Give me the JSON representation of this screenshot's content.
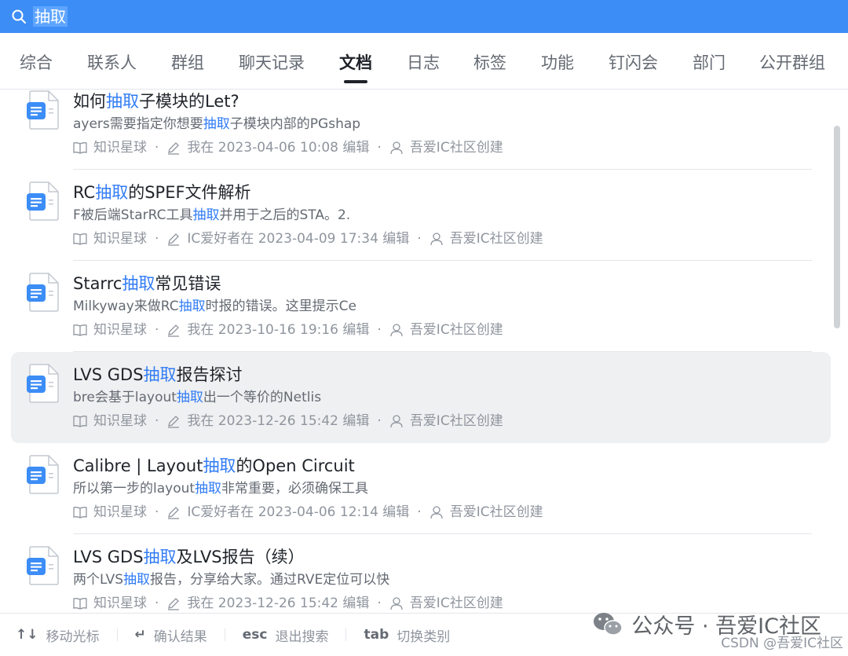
{
  "search": {
    "query": "抽取"
  },
  "tabs": [
    {
      "label": "综合"
    },
    {
      "label": "联系人"
    },
    {
      "label": "群组"
    },
    {
      "label": "聊天记录"
    },
    {
      "label": "文档",
      "active": true
    },
    {
      "label": "日志"
    },
    {
      "label": "标签"
    },
    {
      "label": "功能"
    },
    {
      "label": "钉闪会"
    },
    {
      "label": "部门"
    },
    {
      "label": "公开群组"
    }
  ],
  "results": [
    {
      "title_pre": "如何",
      "title_hl": "抽取",
      "title_post": "子模块的Let?",
      "snippet_pre": "ayers需要指定你想要",
      "snippet_hl": "抽取",
      "snippet_post": "子模块内部的PGshap",
      "space": "知识星球",
      "edited": "我在 2023-04-06 10:08 编辑",
      "creator": "吾爱IC社区创建"
    },
    {
      "title_pre": "RC",
      "title_hl": "抽取",
      "title_post": "的SPEF文件解析",
      "snippet_pre": "F被后端StarRC工具",
      "snippet_hl": "抽取",
      "snippet_post": "并用于之后的STA。2.",
      "space": "知识星球",
      "edited": "IC爱好者在 2023-04-09 17:34 编辑",
      "creator": "吾爱IC社区创建"
    },
    {
      "title_pre": "Starrc",
      "title_hl": "抽取",
      "title_post": "常见错误",
      "snippet_pre": "Milkyway来做RC",
      "snippet_hl": "抽取",
      "snippet_post": "时报的错误。这里提示Ce",
      "space": "知识星球",
      "edited": "我在 2023-10-16 19:16 编辑",
      "creator": "吾爱IC社区创建"
    },
    {
      "title_pre": "LVS GDS",
      "title_hl": "抽取",
      "title_post": "报告探讨",
      "snippet_pre": "bre会基于layout",
      "snippet_hl": "抽取",
      "snippet_post": "出一个等价的Netlis",
      "space": "知识星球",
      "edited": "我在 2023-12-26 15:42 编辑",
      "creator": "吾爱IC社区创建",
      "hover": true
    },
    {
      "title_pre": "Calibre | Layout",
      "title_hl": "抽取",
      "title_post": "的Open Circuit",
      "snippet_pre": "所以第一步的layout",
      "snippet_hl": "抽取",
      "snippet_post": "非常重要，必须确保工具",
      "space": "知识星球",
      "edited": "IC爱好者在 2023-04-06 12:14 编辑",
      "creator": "吾爱IC社区创建"
    },
    {
      "title_pre": "LVS GDS",
      "title_hl": "抽取",
      "title_post": "及LVS报告（续）",
      "snippet_pre": "两个LVS",
      "snippet_hl": "抽取",
      "snippet_post": "报告，分享给大家。通过RVE定位可以快",
      "space": "知识星球",
      "edited": "我在 2023-12-26 15:42 编辑",
      "creator": "吾爱IC社区创建"
    }
  ],
  "footer": {
    "hints": [
      {
        "key": "↑↓",
        "label": "移动光标"
      },
      {
        "key": "↵",
        "label": "确认结果"
      },
      {
        "key": "esc",
        "label": "退出搜索"
      },
      {
        "key": "tab",
        "label": "切换类别"
      }
    ],
    "watermark": "公众号 · 吾爱IC社区",
    "csdn": "CSDN @吾爱IC社区"
  },
  "colors": {
    "accent": "#3c8df6",
    "highlight": "#2f7bf5",
    "doc_icon": "#3c8df6"
  }
}
